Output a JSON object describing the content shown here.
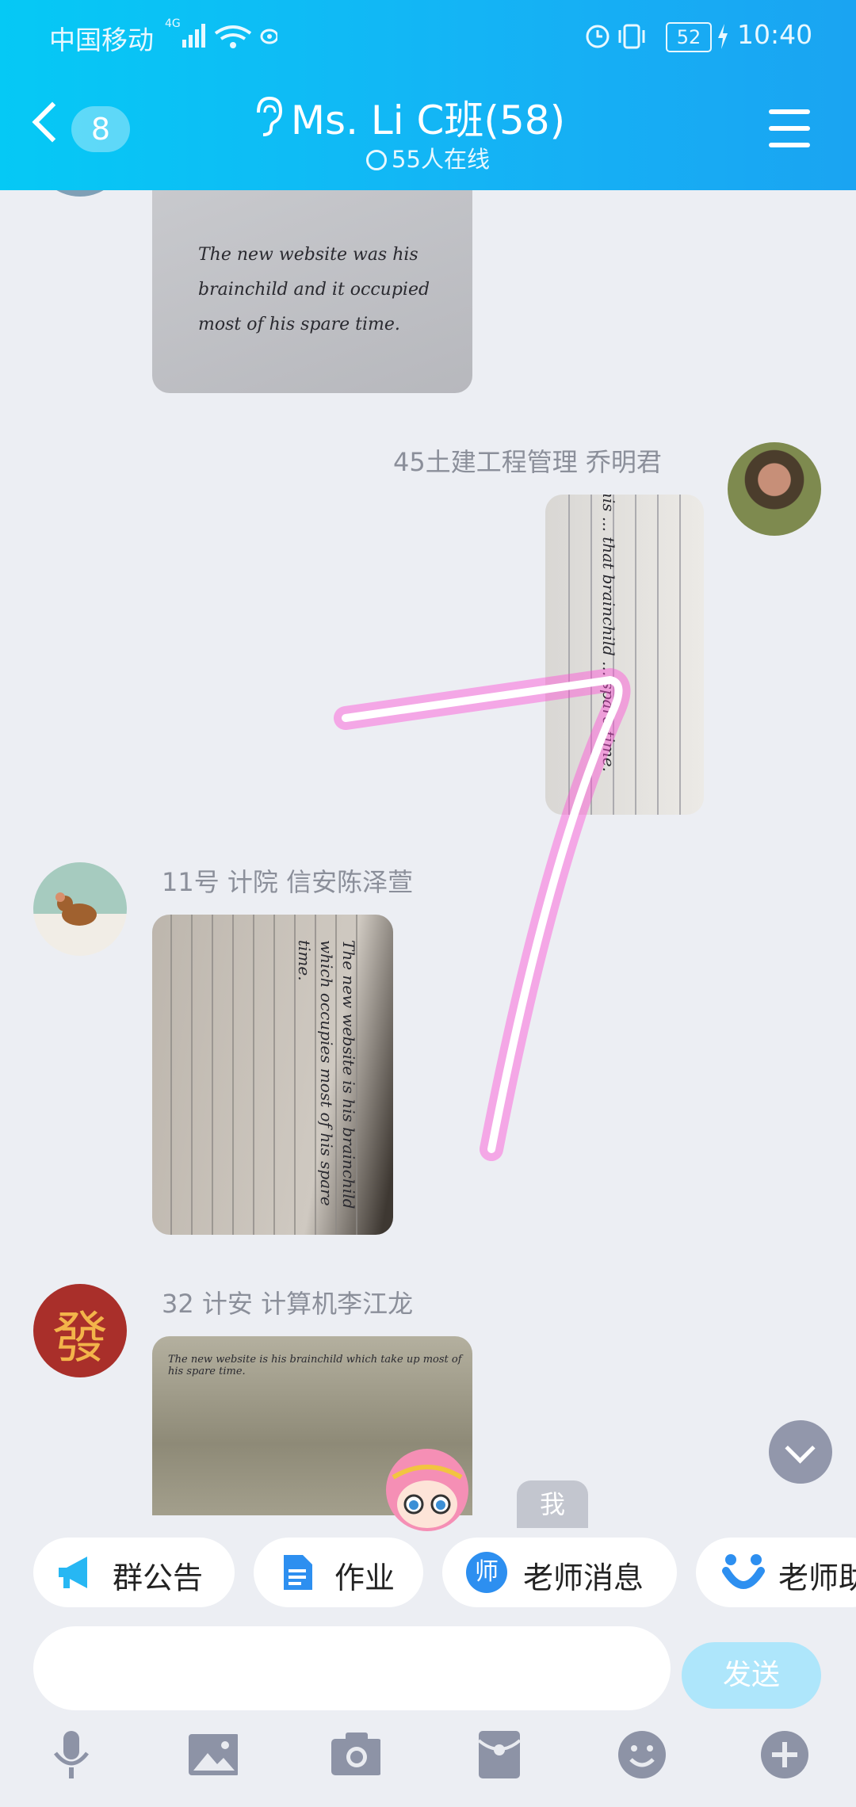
{
  "status_bar": {
    "carrier": "中国移动",
    "network": "4G",
    "battery": "52",
    "time": "10:40"
  },
  "header": {
    "back_count": "8",
    "title": "Ms. Li C班(58)",
    "online": "55人在线"
  },
  "messages": [
    {
      "sender": "",
      "side": "left",
      "text": "The new website was his brainchild and it occupied most of his spare time."
    },
    {
      "sender": "45土建工程管理 乔明君",
      "side": "right",
      "text": "his ... that brainchild ... spare time."
    },
    {
      "sender": "11号 计院 信安陈泽萱",
      "side": "left",
      "text": "The new website is his brainchild which occupies most of his spare time."
    },
    {
      "sender": "32 计安 计算机李江龙",
      "side": "left",
      "text": "The new website is his brainchild which take up most of his spare time."
    }
  ],
  "avatar_text": {
    "fa": "發"
  },
  "me_label": "我",
  "quick_bar": [
    {
      "label": "群公告",
      "icon": "megaphone-icon"
    },
    {
      "label": "作业",
      "icon": "document-icon"
    },
    {
      "label": "老师消息",
      "icon": "teacher-icon",
      "icon_char": "师"
    },
    {
      "label": "老师助",
      "icon": "smile-badge-icon"
    }
  ],
  "composer": {
    "send_label": "发送"
  },
  "toolbar": [
    "microphone-icon",
    "image-icon",
    "camera-icon",
    "red-packet-icon",
    "emoji-icon",
    "plus-icon"
  ],
  "colors": {
    "accent": "#12b7f5",
    "gesture": "#ff3fd0"
  }
}
